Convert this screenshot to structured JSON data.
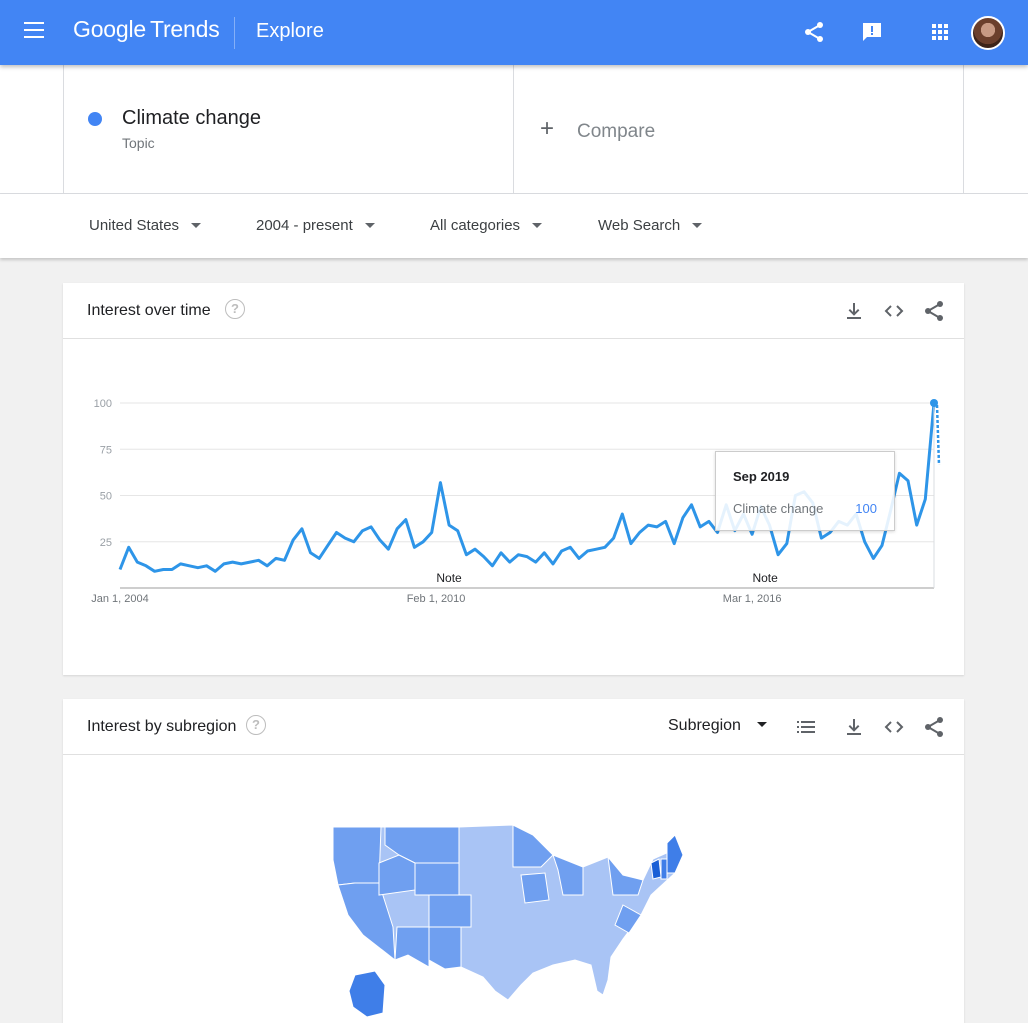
{
  "header": {
    "logo_google": "Google",
    "logo_trends": "Trends",
    "page_title": "Explore",
    "icons": [
      "menu-icon",
      "share-icon",
      "feedback-icon",
      "apps-icon",
      "avatar"
    ],
    "bar_color": "#4285f4"
  },
  "search_terms": {
    "term_name": "Climate change",
    "term_type": "Topic",
    "term_color": "#4285f4",
    "compare_label": "Compare"
  },
  "filters": {
    "region": "United States",
    "time_range": "2004 - present",
    "category": "All categories",
    "search_type": "Web Search"
  },
  "interest_over_time": {
    "title": "Interest over time",
    "help_glyph": "?",
    "tooltip": {
      "date": "Sep 2019",
      "series": "Climate change",
      "value": "100"
    }
  },
  "chart_data": {
    "type": "line",
    "title": "",
    "xlabel": "",
    "ylabel": "",
    "ylim": [
      0,
      100
    ],
    "yticks": [
      25,
      50,
      75,
      100
    ],
    "xtick_labels": [
      "Jan 1, 2004",
      "Feb 1, 2010",
      "Mar 1, 2016"
    ],
    "annotations": [
      {
        "label": "Note",
        "x": "2010-05"
      },
      {
        "label": "Note",
        "x": "2016-06"
      }
    ],
    "grid": true,
    "series": [
      {
        "name": "Climate change",
        "color": "#2e95e8",
        "x": [
          "2004-01",
          "2004-03",
          "2004-05",
          "2004-07",
          "2004-09",
          "2004-11",
          "2005-01",
          "2005-03",
          "2005-05",
          "2005-07",
          "2005-09",
          "2005-11",
          "2006-01",
          "2006-03",
          "2006-05",
          "2006-07",
          "2006-09",
          "2006-11",
          "2007-01",
          "2007-03",
          "2007-05",
          "2007-07",
          "2007-09",
          "2007-11",
          "2008-01",
          "2008-03",
          "2008-05",
          "2008-07",
          "2008-09",
          "2008-11",
          "2009-01",
          "2009-03",
          "2009-05",
          "2009-07",
          "2009-09",
          "2009-11",
          "2010-01",
          "2010-03",
          "2010-05",
          "2010-07",
          "2010-09",
          "2010-11",
          "2011-01",
          "2011-03",
          "2011-05",
          "2011-07",
          "2011-09",
          "2011-11",
          "2012-01",
          "2012-03",
          "2012-05",
          "2012-07",
          "2012-09",
          "2012-11",
          "2013-01",
          "2013-03",
          "2013-05",
          "2013-07",
          "2013-09",
          "2013-11",
          "2014-01",
          "2014-03",
          "2014-05",
          "2014-07",
          "2014-09",
          "2014-11",
          "2015-01",
          "2015-03",
          "2015-05",
          "2015-07",
          "2015-09",
          "2015-11",
          "2016-01",
          "2016-03",
          "2016-05",
          "2016-07",
          "2016-09",
          "2016-11",
          "2017-01",
          "2017-03",
          "2017-05",
          "2017-07",
          "2017-09",
          "2017-11",
          "2018-01",
          "2018-03",
          "2018-05",
          "2018-07",
          "2018-09",
          "2018-11",
          "2019-01",
          "2019-03",
          "2019-05",
          "2019-07",
          "2019-09"
        ],
        "values": [
          10,
          22,
          14,
          12,
          9,
          10,
          10,
          13,
          12,
          11,
          12,
          9,
          13,
          14,
          13,
          14,
          15,
          12,
          16,
          15,
          26,
          32,
          19,
          16,
          23,
          30,
          27,
          25,
          31,
          33,
          26,
          21,
          32,
          37,
          22,
          25,
          30,
          57,
          34,
          31,
          18,
          21,
          17,
          12,
          19,
          14,
          18,
          17,
          14,
          19,
          13,
          20,
          22,
          16,
          20,
          21,
          22,
          27,
          40,
          24,
          30,
          34,
          33,
          36,
          24,
          38,
          45,
          33,
          36,
          30,
          45,
          31,
          40,
          29,
          44,
          34,
          18,
          24,
          50,
          52,
          46,
          27,
          30,
          36,
          34,
          40,
          25,
          16,
          23,
          42,
          62,
          58,
          34,
          48,
          100
        ]
      }
    ]
  },
  "interest_by_subregion": {
    "title": "Interest by subregion",
    "help_glyph": "?",
    "resolution_select": "Subregion",
    "map_colors": {
      "light": "#a9c4f5",
      "medium": "#6f9ff0",
      "dark": "#3f7ee8",
      "darkest": "#1a5fd6"
    }
  }
}
